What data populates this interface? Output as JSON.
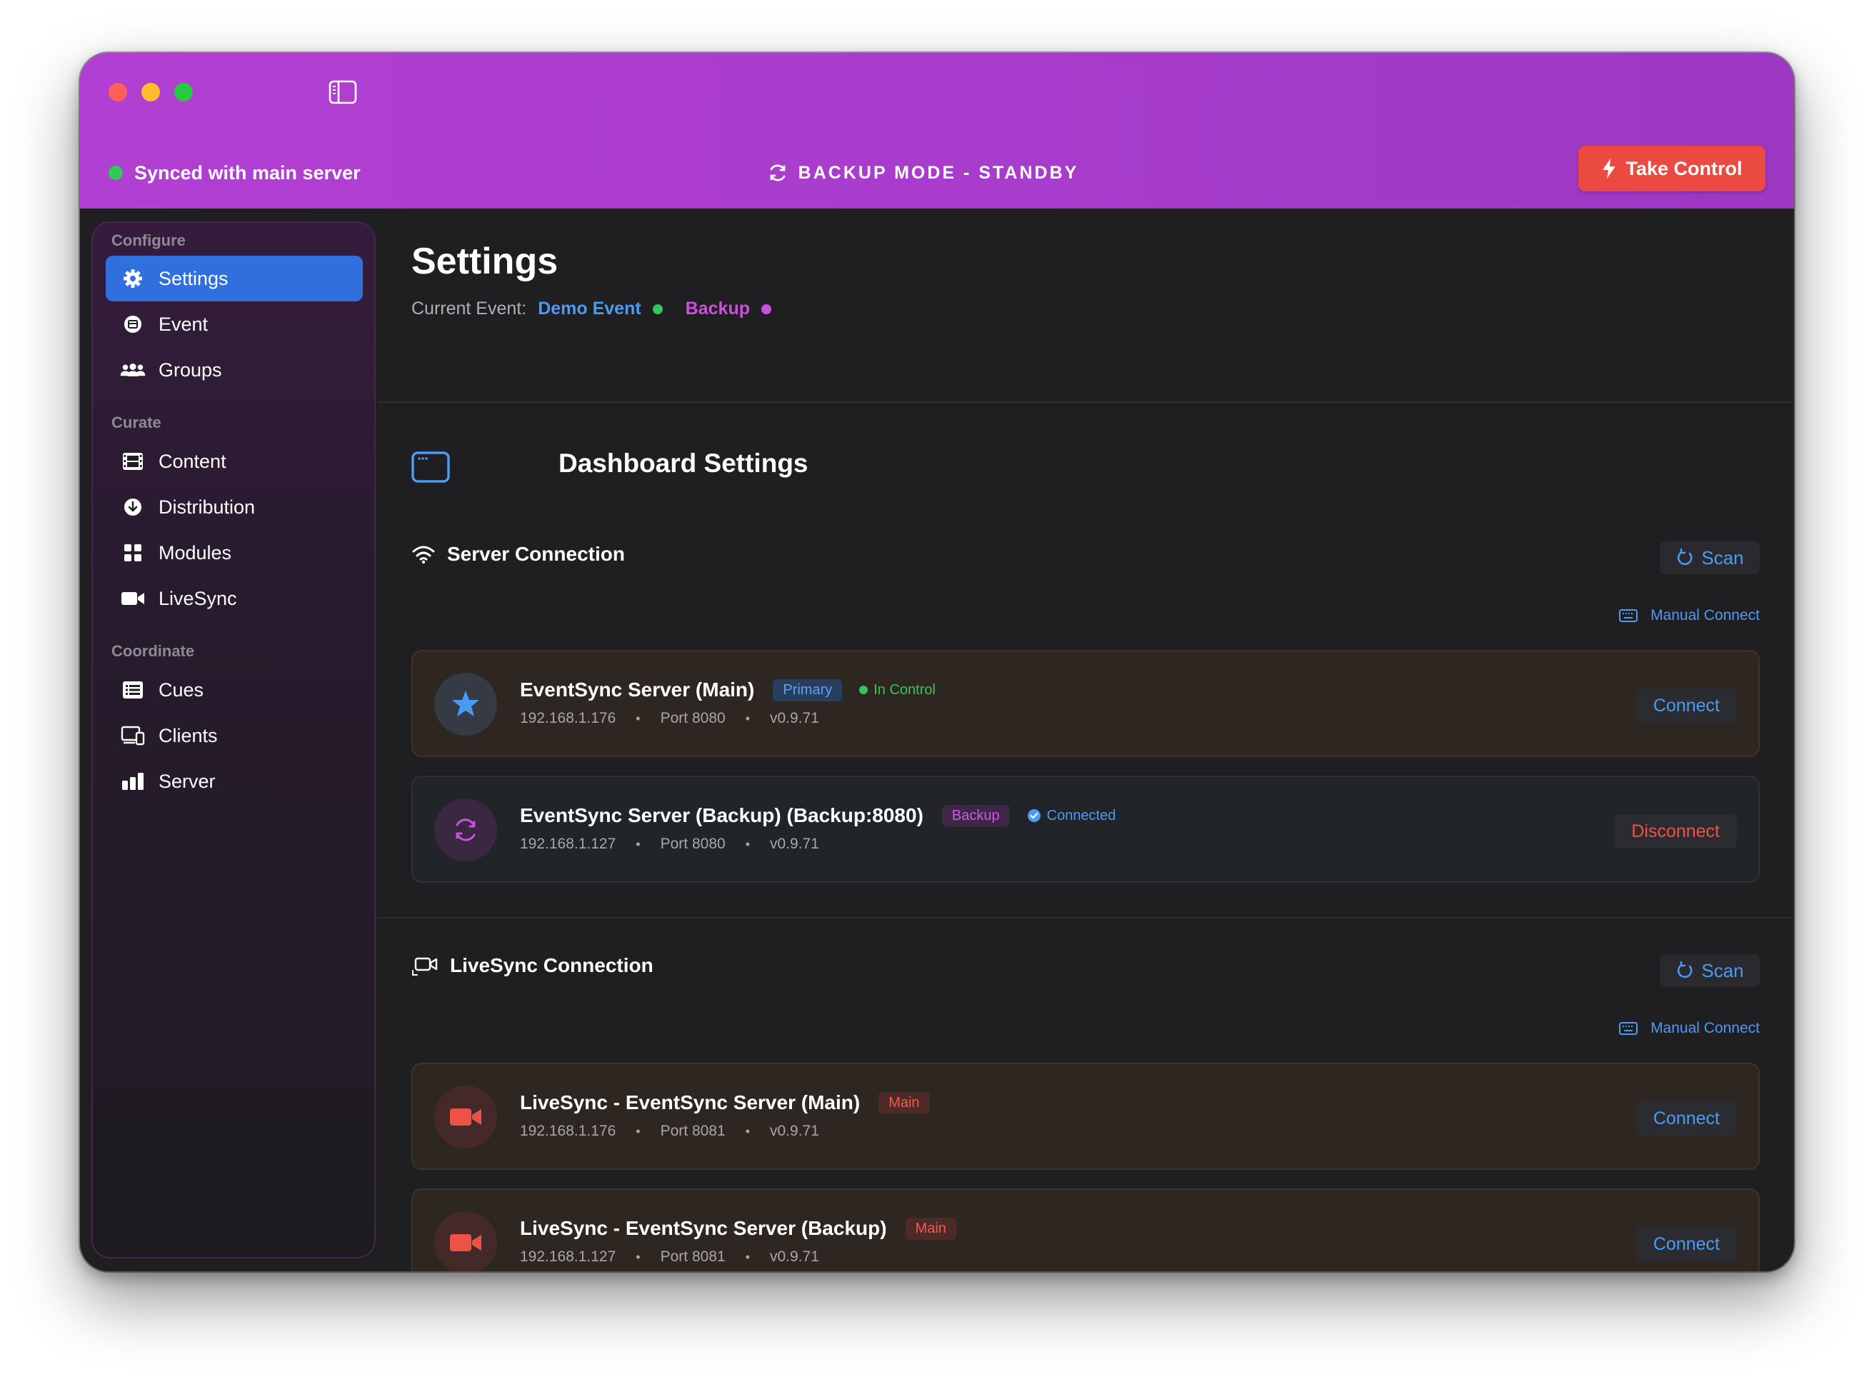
{
  "titlebar": {
    "sync_status": "Synced with main server",
    "mode_label": "BACKUP MODE - STANDBY",
    "take_control_label": "Take Control"
  },
  "sidebar": {
    "sections": [
      {
        "label": "Configure",
        "items": [
          {
            "label": "Settings",
            "icon": "gear-icon",
            "active": true
          },
          {
            "label": "Event",
            "icon": "event-icon",
            "active": false
          },
          {
            "label": "Groups",
            "icon": "people-icon",
            "active": false
          }
        ]
      },
      {
        "label": "Curate",
        "items": [
          {
            "label": "Content",
            "icon": "film-icon",
            "active": false
          },
          {
            "label": "Distribution",
            "icon": "download-circle-icon",
            "active": false
          },
          {
            "label": "Modules",
            "icon": "grid-icon",
            "active": false
          },
          {
            "label": "LiveSync",
            "icon": "video-camera-icon",
            "active": false
          }
        ]
      },
      {
        "label": "Coordinate",
        "items": [
          {
            "label": "Cues",
            "icon": "list-icon",
            "active": false
          },
          {
            "label": "Clients",
            "icon": "devices-icon",
            "active": false
          },
          {
            "label": "Server",
            "icon": "bar-chart-icon",
            "active": false
          }
        ]
      }
    ]
  },
  "header": {
    "title": "Settings",
    "current_event_label": "Current Event:",
    "event_name": "Demo Event",
    "mode_name": "Backup"
  },
  "dashboard": {
    "title": "Dashboard Settings",
    "server_connection": {
      "title": "Server Connection",
      "scan_label": "Scan",
      "manual_connect_label": "Manual Connect",
      "servers": [
        {
          "name": "EventSync Server (Main)",
          "badge": "Primary",
          "status": "In Control",
          "ip": "192.168.1.176",
          "port": "Port 8080",
          "version": "v0.9.71",
          "action": "Connect"
        },
        {
          "name": "EventSync Server (Backup) (Backup:8080)",
          "badge": "Backup",
          "status": "Connected",
          "ip": "192.168.1.127",
          "port": "Port 8080",
          "version": "v0.9.71",
          "action": "Disconnect"
        }
      ]
    },
    "livesync_connection": {
      "title": "LiveSync Connection",
      "scan_label": "Scan",
      "manual_connect_label": "Manual Connect",
      "servers": [
        {
          "name": "LiveSync - EventSync Server (Main)",
          "badge": "Main",
          "ip": "192.168.1.176",
          "port": "Port 8081",
          "version": "v0.9.71",
          "action": "Connect"
        },
        {
          "name": "LiveSync - EventSync Server (Backup)",
          "badge": "Main",
          "ip": "192.168.1.127",
          "port": "Port 8081",
          "version": "v0.9.71",
          "action": "Connect"
        }
      ]
    }
  },
  "meta_separator": "•",
  "colors": {
    "accent_blue": "#4b9bf5",
    "accent_purple": "#cd4fe0",
    "danger_red": "#eb4a41",
    "success_green": "#34c759"
  }
}
